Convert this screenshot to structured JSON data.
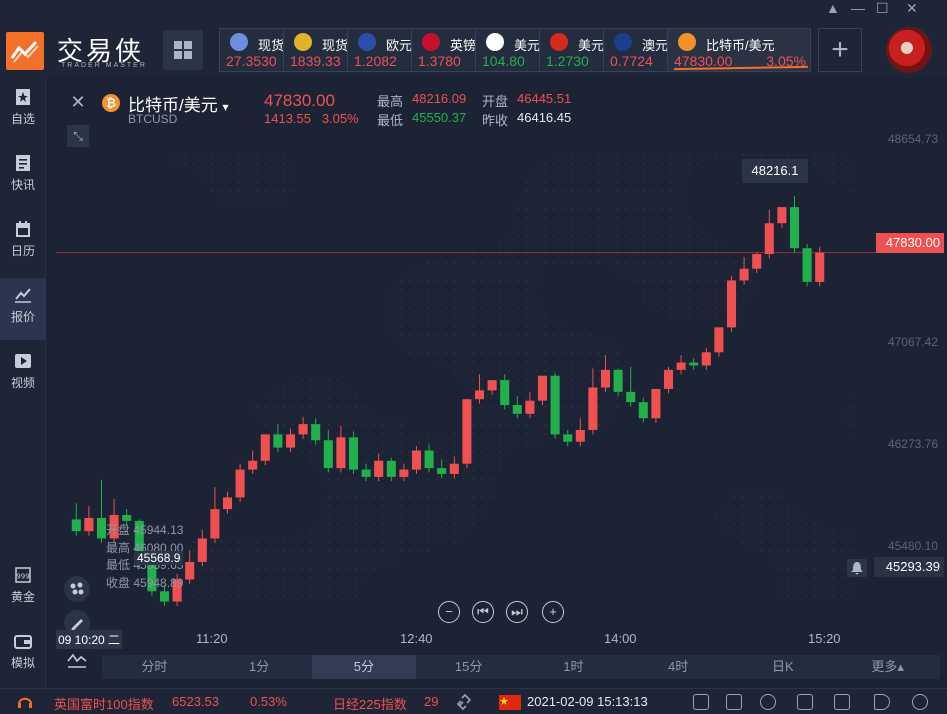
{
  "app": {
    "logo_text": "交易侠",
    "logo_sub": "TRADER MASTER",
    "window_controls": [
      "▲",
      "—",
      "☐",
      "✕"
    ]
  },
  "tickers": [
    {
      "name": "现货",
      "price": "27.3530",
      "change": "",
      "icon": "silver-icon",
      "icon_color": "#6e8fe0",
      "price_color": "#f05050"
    },
    {
      "name": "现货",
      "price": "1839.33",
      "change": "",
      "icon": "gold-icon",
      "icon_color": "#e0b32a",
      "price_color": "#f05050"
    },
    {
      "name": "欧元",
      "price": "1.2082",
      "change": "",
      "icon": "eu-flag-icon",
      "icon_color": "#2b4fa8",
      "price_color": "#f05050"
    },
    {
      "name": "英镑",
      "price": "1.3780",
      "change": "",
      "icon": "uk-flag-icon",
      "icon_color": "#c8102e",
      "price_color": "#f05050"
    },
    {
      "name": "美元",
      "price": "104.80",
      "change": "",
      "icon": "jp-flag-icon",
      "icon_color": "#ffffff",
      "price_color": "#21b04b"
    },
    {
      "name": "美元",
      "price": "1.2730",
      "change": "",
      "icon": "ca-flag-icon",
      "icon_color": "#d52b1e",
      "price_color": "#21b04b"
    },
    {
      "name": "澳元",
      "price": "0.7724",
      "change": "",
      "icon": "au-flag-icon",
      "icon_color": "#1b3f8a",
      "price_color": "#f05050"
    },
    {
      "name": "比特币/美元",
      "price": "47830.00",
      "change": "3.05%",
      "icon": "bitcoin-icon",
      "icon_color": "#f3922a",
      "price_color": "#f05050"
    }
  ],
  "add_label": "+",
  "nav": [
    {
      "label": "自选",
      "icon": "watchlist-icon"
    },
    {
      "label": "快讯",
      "icon": "news-icon"
    },
    {
      "label": "日历",
      "icon": "calendar-icon"
    },
    {
      "label": "报价",
      "icon": "quote-chart-icon"
    },
    {
      "label": "视频",
      "icon": "video-icon"
    },
    {
      "label": "黄金",
      "icon": "gold-bar-icon"
    },
    {
      "label": "模拟",
      "icon": "wallet-icon"
    }
  ],
  "symbol": {
    "name": "比特币/美元",
    "dropdown": "▾",
    "code": "BTCUSD",
    "price": "47830.00",
    "change_abs": "1413.55",
    "change_pct": "3.05%",
    "high_label": "最高",
    "high": "48216.09",
    "low_label": "最低",
    "low": "45550.37",
    "open_label": "开盘",
    "open": "46445.51",
    "prev_label": "昨收",
    "prev": "46416.45"
  },
  "chart_data": {
    "type": "candlestick",
    "y_ticks": [
      "48654.73",
      "47067.42",
      "46273.76",
      "45480.10"
    ],
    "current_price_tag": "47830.00",
    "high_tag": "48216.1",
    "low_tag": "45293.39",
    "x_ticks": [
      "11:20",
      "12:40",
      "14:00",
      "15:20"
    ],
    "x_cursor_label": "09 10:20 二",
    "candles": [
      {
        "o": 46010,
        "h": 46120,
        "c": 45930
      },
      {
        "o": 45930,
        "h": 46100,
        "c": 46020
      },
      {
        "o": 46020,
        "h": 46280,
        "c": 45880
      },
      {
        "o": 45880,
        "h": 46150,
        "c": 46040
      },
      {
        "o": 46040,
        "h": 46080,
        "c": 46000
      },
      {
        "o": 46000,
        "h": 46010,
        "c": 45700
      },
      {
        "o": 45700,
        "h": 45720,
        "c": 45520
      },
      {
        "o": 45520,
        "h": 45560,
        "c": 45450
      },
      {
        "o": 45450,
        "h": 45640,
        "c": 45600
      },
      {
        "o": 45600,
        "h": 45800,
        "c": 45720
      },
      {
        "o": 45720,
        "h": 45940,
        "c": 45880
      },
      {
        "o": 45880,
        "h": 46230,
        "c": 46080
      },
      {
        "o": 46080,
        "h": 46200,
        "c": 46160
      },
      {
        "o": 46160,
        "h": 46390,
        "c": 46350
      },
      {
        "o": 46350,
        "h": 46480,
        "c": 46410
      },
      {
        "o": 46410,
        "h": 46530,
        "c": 46590
      },
      {
        "o": 46590,
        "h": 46660,
        "c": 46500
      },
      {
        "o": 46500,
        "h": 46630,
        "c": 46590
      },
      {
        "o": 46590,
        "h": 46710,
        "c": 46660
      },
      {
        "o": 46660,
        "h": 46700,
        "c": 46550
      },
      {
        "o": 46550,
        "h": 46620,
        "c": 46360
      },
      {
        "o": 46360,
        "h": 46650,
        "c": 46570
      },
      {
        "o": 46570,
        "h": 46610,
        "c": 46350
      },
      {
        "o": 46350,
        "h": 46390,
        "c": 46300
      },
      {
        "o": 46300,
        "h": 46460,
        "c": 46410
      },
      {
        "o": 46410,
        "h": 46430,
        "c": 46300
      },
      {
        "o": 46300,
        "h": 46390,
        "c": 46350
      },
      {
        "o": 46350,
        "h": 46510,
        "c": 46480
      },
      {
        "o": 46480,
        "h": 46520,
        "c": 46360
      },
      {
        "o": 46360,
        "h": 46420,
        "c": 46320
      },
      {
        "o": 46320,
        "h": 46440,
        "c": 46390
      },
      {
        "o": 46390,
        "h": 46810,
        "c": 46830
      },
      {
        "o": 46830,
        "h": 47000,
        "c": 46890
      },
      {
        "o": 46890,
        "h": 46940,
        "c": 46960
      },
      {
        "o": 46960,
        "h": 47000,
        "c": 46790
      },
      {
        "o": 46790,
        "h": 46850,
        "c": 46730
      },
      {
        "o": 46730,
        "h": 46880,
        "c": 46820
      },
      {
        "o": 46820,
        "h": 46980,
        "c": 46990
      },
      {
        "o": 46990,
        "h": 47010,
        "c": 46590
      },
      {
        "o": 46590,
        "h": 46620,
        "c": 46540
      },
      {
        "o": 46540,
        "h": 46700,
        "c": 46620
      },
      {
        "o": 46620,
        "h": 47040,
        "c": 46910
      },
      {
        "o": 46910,
        "h": 47130,
        "c": 47030
      },
      {
        "o": 47030,
        "h": 47040,
        "c": 46880
      },
      {
        "o": 46880,
        "h": 47050,
        "c": 46810
      },
      {
        "o": 46810,
        "h": 46840,
        "c": 46700
      },
      {
        "o": 46700,
        "h": 46860,
        "c": 46900
      },
      {
        "o": 46900,
        "h": 47050,
        "c": 47030
      },
      {
        "o": 47030,
        "h": 47130,
        "c": 47080
      },
      {
        "o": 47080,
        "h": 47110,
        "c": 47060
      },
      {
        "o": 47060,
        "h": 47180,
        "c": 47150
      },
      {
        "o": 47150,
        "h": 47300,
        "c": 47320
      },
      {
        "o": 47320,
        "h": 47670,
        "c": 47640
      },
      {
        "o": 47640,
        "h": 47800,
        "c": 47720
      },
      {
        "o": 47720,
        "h": 47830,
        "c": 47820
      },
      {
        "o": 47820,
        "h": 48120,
        "c": 48030
      },
      {
        "o": 48030,
        "h": 48090,
        "c": 48140
      },
      {
        "o": 48140,
        "h": 48216,
        "c": 47860
      },
      {
        "o": 47860,
        "h": 47890,
        "c": 47630
      },
      {
        "o": 47630,
        "h": 47870,
        "c": 47830
      }
    ],
    "y_min": 45290,
    "y_max": 48700
  },
  "ohlc_box": {
    "open_label": "开盘",
    "open": "45944.13",
    "high_label": "最高",
    "high": "46080.00",
    "low_label": "最低",
    "low": "45559.65",
    "close_label": "收盘",
    "close": "45948.89",
    "cursor_price": "45568.9"
  },
  "nav_controls": [
    "−",
    "⏮",
    "⏭",
    "+"
  ],
  "periods": [
    "分时",
    "1分",
    "5分",
    "15分",
    "1时",
    "4时",
    "日K",
    "更多▴"
  ],
  "active_period": "5分",
  "statusbar": {
    "index1_name": "英国富时100指数",
    "index1_value": "6523.53",
    "index1_change": "0.53%",
    "index2_name": "日经225指数",
    "index2_value": "29",
    "datetime": "2021-02-09 15:13:13"
  }
}
